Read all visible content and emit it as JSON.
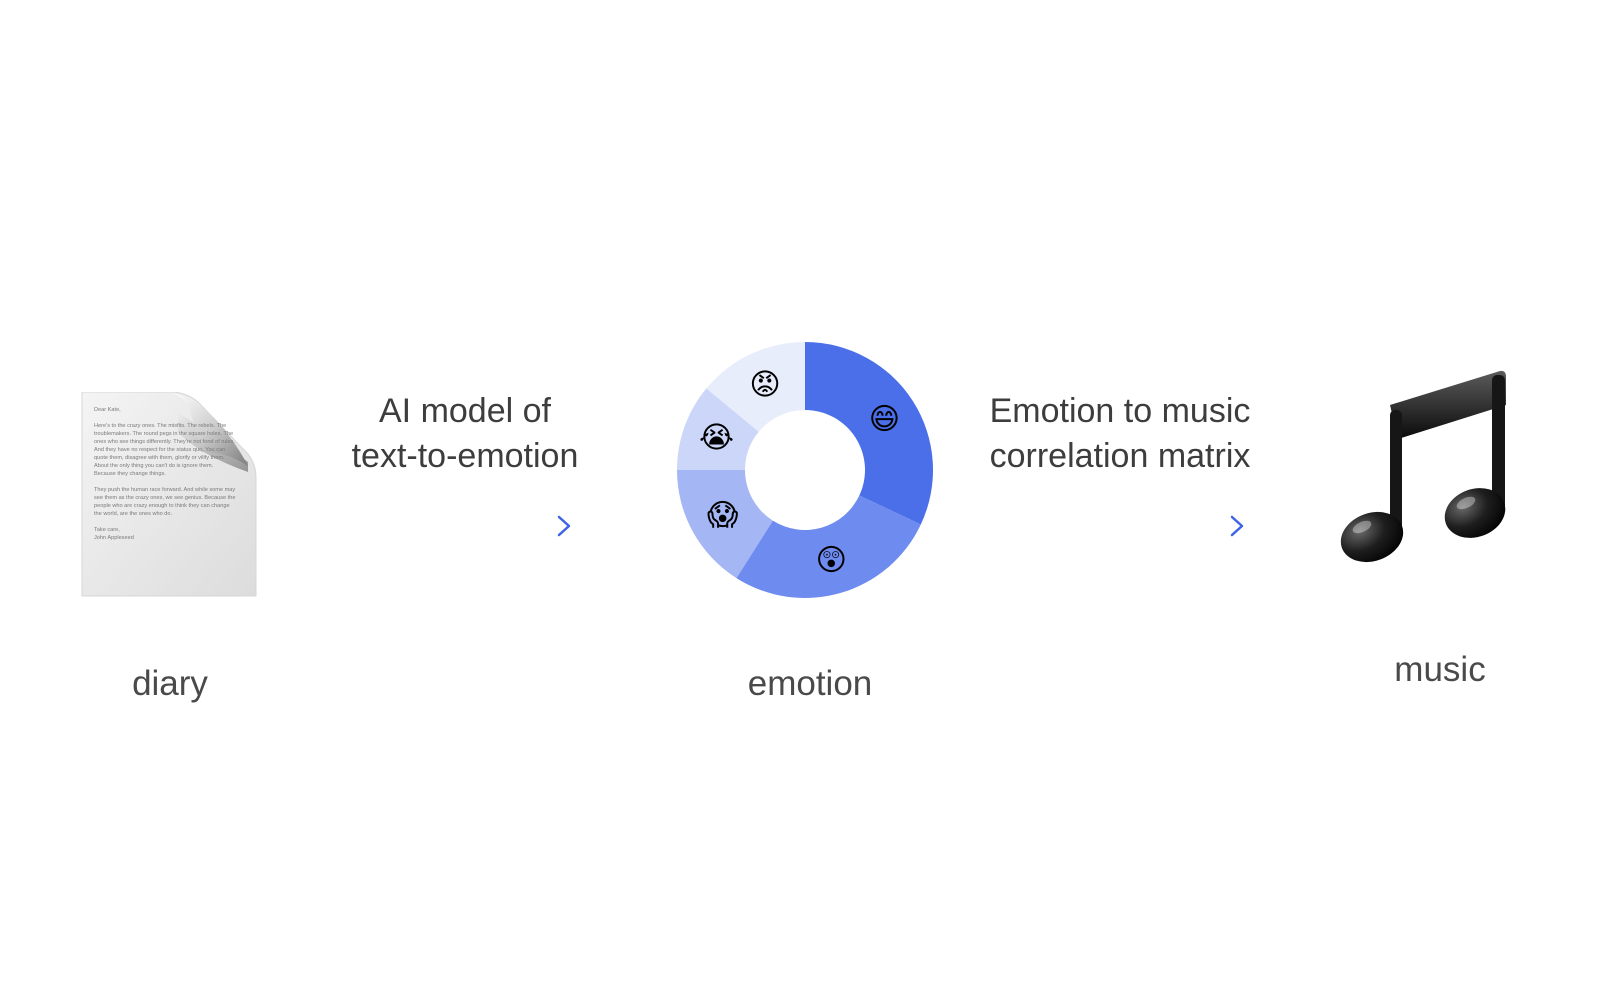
{
  "diagram": {
    "nodes": {
      "diary": {
        "caption": "diary",
        "icon": "document-icon",
        "document_text": "Dear Kate,\n\nHere's to the crazy ones. The misfits. The rebels. The troublemakers. The round pegs in the square holes. The ones who see things differently. They're not fond of rules. And they have no respect for the status quo. You can quote them, disagree with them, glorify or vilify them. About the only thing you can't do is ignore them. Because they change things.\n\nThey push the human race forward. And while some may see them as the crazy ones, we see genius. Because the people who are crazy enough to think they can change the world, are the ones who do.\n\nTake care,\nJohn Appleseed"
      },
      "emotion": {
        "caption": "emotion",
        "icon": "donut-chart-icon"
      },
      "music": {
        "caption": "music",
        "icon": "music-note-icon"
      }
    },
    "edges": [
      {
        "label_line1": "AI model of",
        "label_line2": "text-to-emotion"
      },
      {
        "label_line1": "Emotion to music",
        "label_line2": "correlation matrix"
      }
    ],
    "colors": {
      "arrow": "#4a6fe3",
      "text": "#444444"
    }
  },
  "emotion_donut": {
    "segments": [
      {
        "emotion": "happy",
        "emoji": "😄",
        "share": 0.32,
        "color": "#4a6fe8"
      },
      {
        "emotion": "surprised",
        "emoji": "😲",
        "share": 0.27,
        "color": "#6e8bef"
      },
      {
        "emotion": "fearful",
        "emoji": "😱",
        "share": 0.16,
        "color": "#a4b6f4"
      },
      {
        "emotion": "sad",
        "emoji": "😭",
        "share": 0.11,
        "color": "#cbd6f8"
      },
      {
        "emotion": "angry",
        "emoji": "😡",
        "share": 0.14,
        "color": "#e8edfb"
      }
    ]
  }
}
